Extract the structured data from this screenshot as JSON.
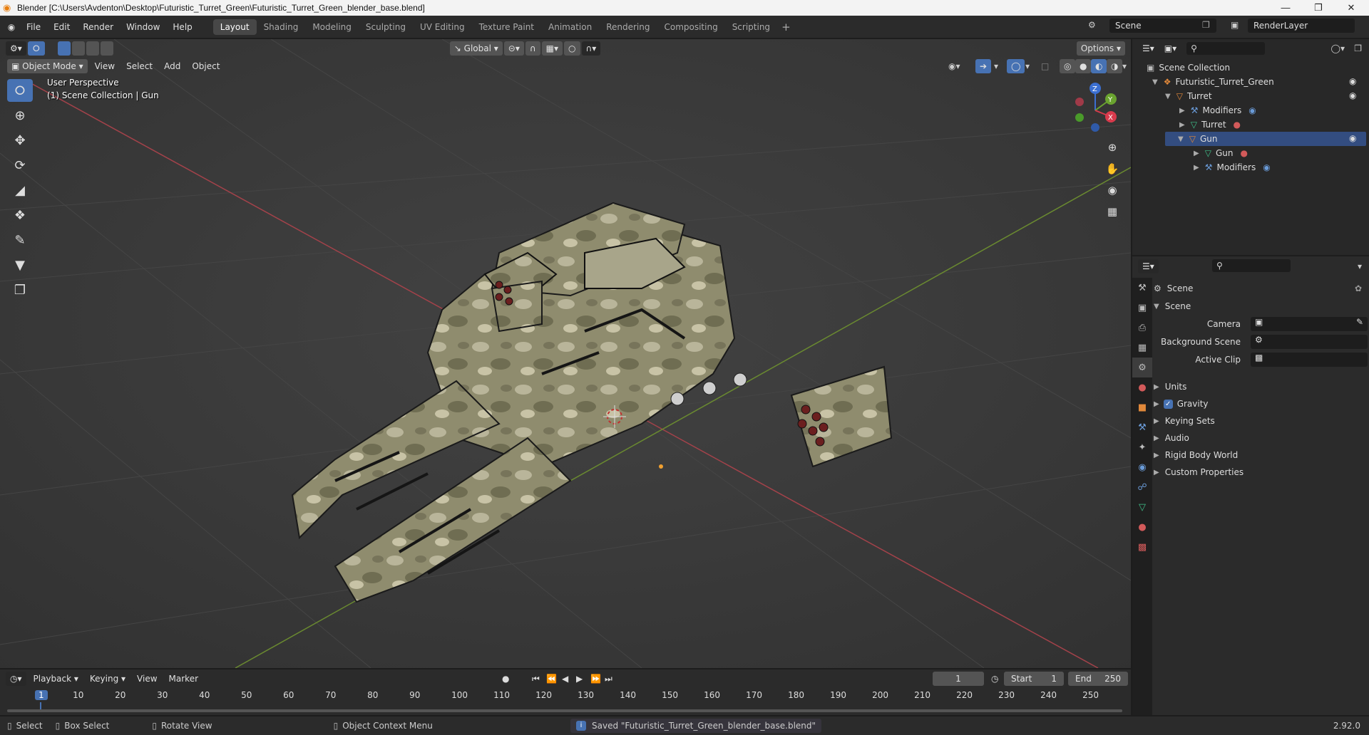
{
  "window": {
    "title": "Blender [C:\\Users\\Avdenton\\Desktop\\Futuristic_Turret_Green\\Futuristic_Turret_Green_blender_base.blend]"
  },
  "menu": [
    "File",
    "Edit",
    "Render",
    "Window",
    "Help"
  ],
  "workspaces": [
    "Layout",
    "Shading",
    "Modeling",
    "Sculpting",
    "UV Editing",
    "Texture Paint",
    "Animation",
    "Rendering",
    "Compositing",
    "Scripting"
  ],
  "scene_name": "Scene",
  "view_layer": "RenderLayer",
  "viewport": {
    "transform_orientation": "Global",
    "options_label": "Options",
    "mode": "Object Mode",
    "header_menu": [
      "View",
      "Select",
      "Add",
      "Object"
    ],
    "perspective_label": "User Perspective",
    "collection_info": "(1) Scene Collection | Gun",
    "gizmo_axes": [
      "Z",
      "Y",
      "X"
    ]
  },
  "outliner": {
    "root": "Scene Collection",
    "items": [
      {
        "label": "Futuristic_Turret_Green",
        "depth": 1
      },
      {
        "label": "Turret",
        "depth": 2
      },
      {
        "label": "Modifiers",
        "depth": 3
      },
      {
        "label": "Turret",
        "depth": 3
      },
      {
        "label": "Gun",
        "depth": 2
      },
      {
        "label": "Gun",
        "depth": 3
      },
      {
        "label": "Modifiers",
        "depth": 3
      }
    ]
  },
  "properties": {
    "context": "Scene",
    "panel_title": "Scene",
    "fields": [
      "Camera",
      "Background Scene",
      "Active Clip"
    ],
    "sections": [
      "Units",
      "Gravity",
      "Keying Sets",
      "Audio",
      "Rigid Body World",
      "Custom Properties"
    ],
    "gravity_enabled": true
  },
  "timeline": {
    "menu": [
      "Playback",
      "Keying",
      "View",
      "Marker"
    ],
    "current_frame": "1",
    "start_label": "Start",
    "start": "1",
    "end_label": "End",
    "end": "250",
    "ticks": [
      "1",
      "10",
      "20",
      "30",
      "40",
      "50",
      "60",
      "70",
      "80",
      "90",
      "100",
      "110",
      "120",
      "130",
      "140",
      "150",
      "160",
      "170",
      "180",
      "190",
      "200",
      "210",
      "220",
      "230",
      "240",
      "250"
    ]
  },
  "status": {
    "select": "Select",
    "box_select": "Box Select",
    "rotate_view": "Rotate View",
    "context_menu": "Object Context Menu",
    "message": "Saved \"Futuristic_Turret_Green_blender_base.blend\"",
    "version": "2.92.0"
  }
}
